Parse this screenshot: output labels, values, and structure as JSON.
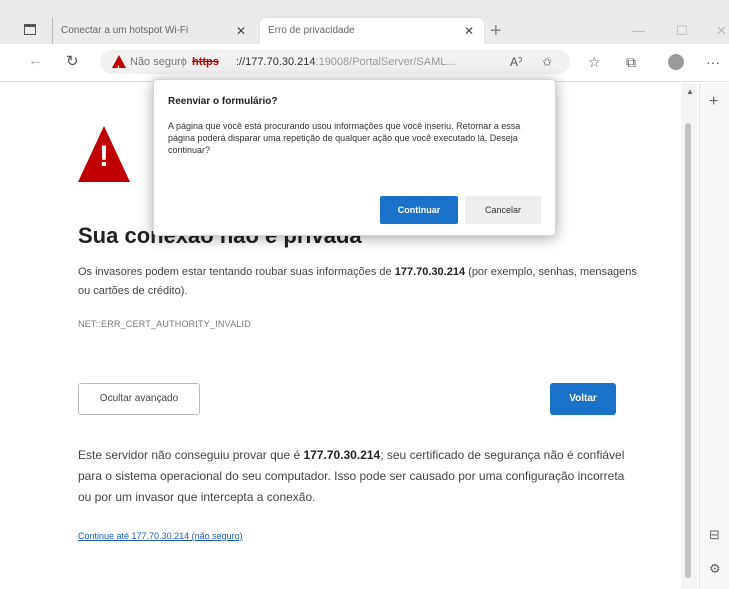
{
  "tabs": [
    {
      "title": "Conectar a um hotspot Wi-Fi",
      "close": "✕"
    },
    {
      "title": "Erro de privacidade",
      "close": "✕"
    }
  ],
  "tabstrip": {
    "new_tab": "+",
    "minimize": "—",
    "maximize": "☐",
    "close": "✕"
  },
  "addressbar": {
    "back": "←",
    "refresh": "↻",
    "security_label": "Não seguro",
    "separator": "|",
    "url_scheme": "https",
    "url_host": "://177.70.30.214",
    "url_path": ":19008/PortalServer/SAML...",
    "read_aloud": "Aˀ",
    "add_favorite": "✩",
    "favorites": "☆",
    "collections": "⧉",
    "more": "···"
  },
  "page": {
    "heading": "Sua conexão não é privada",
    "paragraph1_pre": "Os invasores podem estar tentando roubar suas informações de ",
    "paragraph1_host": "177.70.30.214",
    "paragraph1_post": " (por exemplo, senhas, mensagens ou cartões de crédito).",
    "error_code": "NET::ERR_CERT_AUTHORITY_INVALID",
    "hide_advanced": "Ocultar avançado",
    "back_button": "Voltar",
    "paragraph2_pre": "Este servidor não conseguiu provar que é ",
    "paragraph2_host": "177.70.30.214",
    "paragraph2_post": "; seu certificado de segurança não é confiável para o sistema operacional do seu computador. Isso pode ser causado por uma configuração incorreta ou por um invasor que intercepta a conexão.",
    "proceed_link": "Continue até 177.70.30.214 (não seguro)"
  },
  "dialog": {
    "title": "Reenviar o formulário?",
    "body": "A página que você está procurando usou informações que você inseriu. Retornar a essa página poderá disparar uma repetição de qualquer ação que você executado lá. Deseja continuar?",
    "continue": "Continuar",
    "cancel": "Cancelar"
  },
  "sidebar": {
    "add": "+",
    "split": "⊟",
    "settings": "⚙"
  },
  "colors": {
    "accent": "#1a73c8",
    "danger": "#c00000"
  }
}
